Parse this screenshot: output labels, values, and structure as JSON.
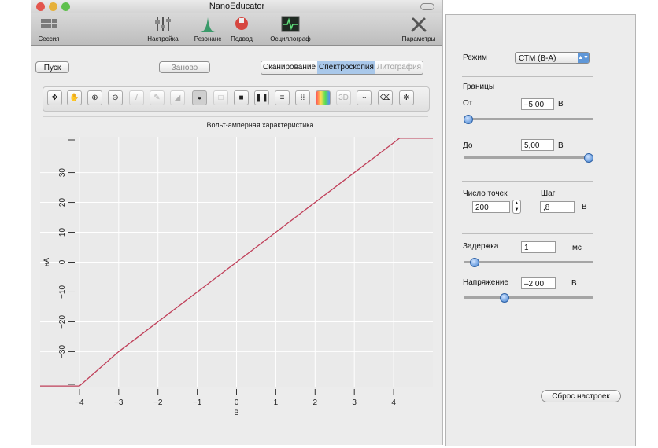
{
  "window": {
    "title": "NanoEducator"
  },
  "toolbar": {
    "items": [
      {
        "label": "Сессия",
        "icon": "session-icon"
      },
      {
        "label": "Настройка",
        "icon": "tuning-icon"
      },
      {
        "label": "Резонанс",
        "icon": "resonance-icon"
      },
      {
        "label": "Подвод",
        "icon": "approach-icon"
      },
      {
        "label": "Осциллограф",
        "icon": "oscilloscope-icon"
      },
      {
        "label": "Параметры",
        "icon": "parameters-icon"
      }
    ]
  },
  "controls": {
    "start": "Пуск",
    "restart": "Заново"
  },
  "mode_tabs": [
    "Сканирование",
    "Спектроскопия",
    "Литография"
  ],
  "active_tab": "Спектроскопия",
  "tool_buttons": [
    "move",
    "hand",
    "zoom-in",
    "zoom-out",
    "picker",
    "pen",
    "area",
    "shield",
    "rect",
    "stop",
    "pause",
    "lines",
    "grid",
    "color",
    "3d",
    "view",
    "eraser",
    "settings"
  ],
  "tool_labels": {
    "3d": "3D"
  },
  "chart_data": {
    "type": "line",
    "title": "Вольт-амперная характеристика",
    "xlabel": "В",
    "ylabel": "нА",
    "xlim": [
      -5,
      5
    ],
    "ylim": [
      -42,
      42
    ],
    "x_ticks": [
      -4,
      -3,
      -2,
      -1,
      0,
      1,
      2,
      3,
      4
    ],
    "y_ticks": [
      -30,
      -20,
      -10,
      0,
      10,
      20,
      30
    ],
    "grid": true,
    "line_color": "#c0405a",
    "series": [
      {
        "x": [
          -5,
          -4,
          -3,
          -2,
          -1,
          0,
          1,
          2,
          3,
          4,
          4.15,
          5
        ],
        "values": [
          -41.5,
          -41.5,
          -30,
          -20,
          -10,
          0,
          10,
          20,
          30,
          40,
          41.5,
          41.5
        ]
      }
    ]
  },
  "settings": {
    "mode_label": "Режим",
    "mode_value": "СТМ (В-А)",
    "bounds_label": "Границы",
    "from_label": "От",
    "from_value": "–5,00",
    "from_unit": "В",
    "from_slider": 0.0,
    "to_label": "До",
    "to_value": "5,00",
    "to_unit": "В",
    "to_slider": 1.0,
    "points_label": "Число точек",
    "points_value": "200",
    "step_label": "Шаг",
    "step_value": ",8",
    "step_unit": "В",
    "delay_label": "Задержка",
    "delay_value": "1",
    "delay_unit": "мс",
    "delay_slider": 0.05,
    "voltage_label": "Напряжение",
    "voltage_value": "–2,00",
    "voltage_unit": "В",
    "voltage_slider": 0.3,
    "reset_label": "Сброс настроек"
  }
}
